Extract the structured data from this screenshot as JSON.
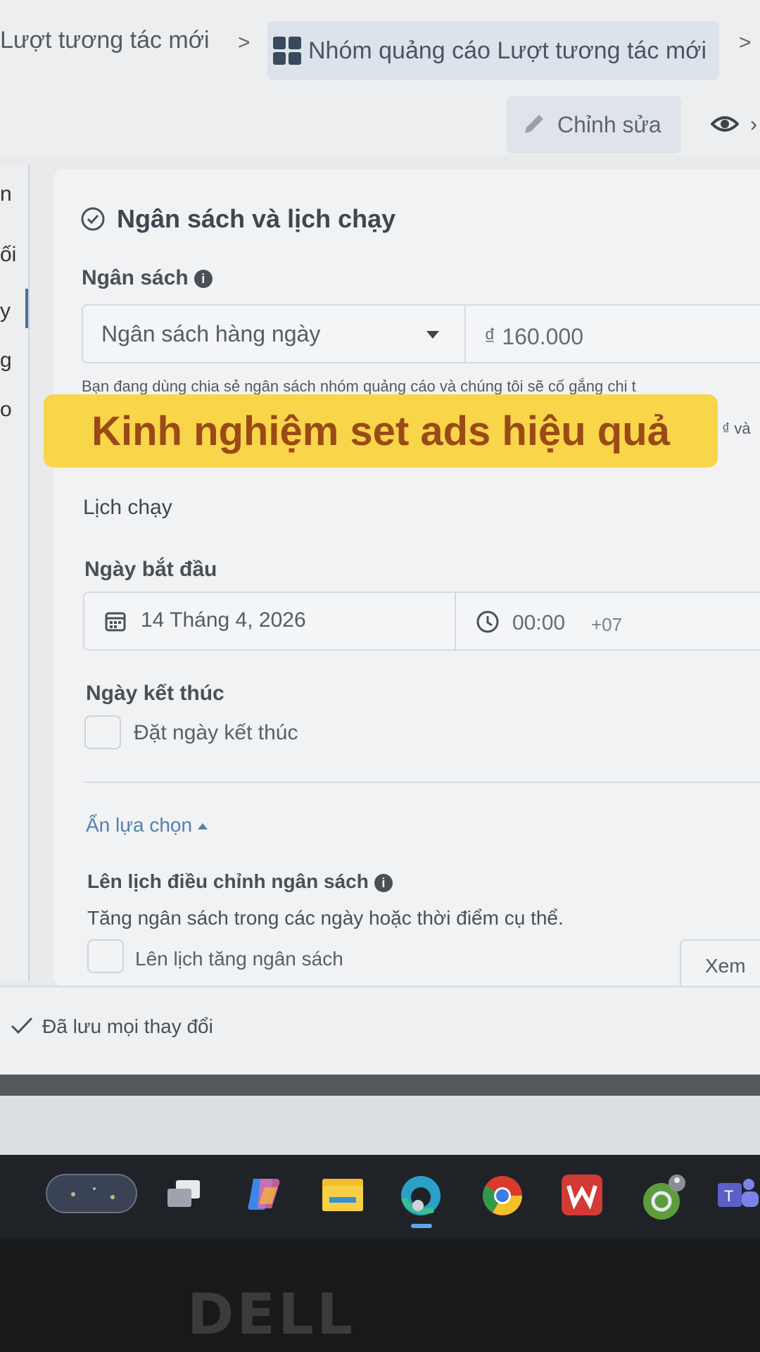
{
  "breadcrumb": {
    "campaign": "Lượt tương tác mới",
    "ad_group": "Nhóm quảng cáo Lượt tương tác mới"
  },
  "toolbar": {
    "edit_label": "Chỉnh sửa"
  },
  "leftnav": {
    "letters": [
      "n",
      "ối",
      "y",
      "g",
      "o"
    ]
  },
  "section": {
    "title": "Ngân sách và lịch chạy",
    "budget_label": "Ngân sách",
    "budget_type": "Ngân sách hàng ngày",
    "budget_amount": "₫ 160.000",
    "budget_note": "Bạn đang dùng chia sẻ ngân sách nhóm quảng cáo và chúng tôi sẽ cố gắng chi t",
    "budget_note_tail": "₫ và",
    "schedule_label": "Lịch chạy",
    "start_date_label": "Ngày bắt đầu",
    "start_date": "14 Tháng 4, 2026",
    "start_time": "00:00",
    "timezone": "+07",
    "end_date_label": "Ngày kết thúc",
    "end_date_checkbox_label": "Đặt ngày kết thúc",
    "toggle_options": "Ẩn lựa chọn",
    "adjust_label": "Lên lịch điều chỉnh ngân sách",
    "adjust_desc": "Tăng ngân sách trong các ngày hoặc thời điểm cụ thể.",
    "increase_checkbox_label": "Lên lịch tăng ngân sách",
    "view_button": "Xem"
  },
  "overlay": {
    "banner_text": "Kinh nghiệm set ads hiệu quả"
  },
  "status": {
    "saved": "Đã lưu mọi thay đổi"
  },
  "taskbar": {
    "items": [
      "widgets",
      "task-view",
      "copilot",
      "file-explorer",
      "edge",
      "chrome",
      "wps-office",
      "phone-link",
      "teams"
    ]
  },
  "hardware": {
    "brand": "DELL"
  }
}
